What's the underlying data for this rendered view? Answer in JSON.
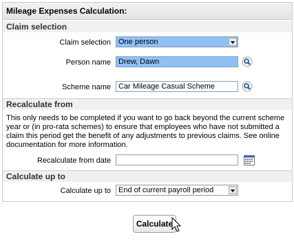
{
  "panel": {
    "title": "Mileage Expenses Calculation:"
  },
  "claim": {
    "heading": "Claim selection",
    "claim_selection_label": "Claim selection",
    "claim_selection_value": "One person",
    "person_label": "Person name",
    "person_value": "Drew, Dawn",
    "scheme_label": "Scheme name",
    "scheme_value": "Car Mileage Casual Scheme"
  },
  "recalc": {
    "heading": "Recalculate from",
    "description": "This only needs to be completed if you want to go back beyond the current scheme year or (in pro-rata schemes) to ensure that employees who have not submitted a claim this period get the benefit of any adjustments to previous claims. See online documentation for more information.",
    "date_label": "Recalculate from date",
    "date_value": ""
  },
  "calc": {
    "heading": "Calculate up to",
    "label": "Calculate up to",
    "value": "End of current payroll period"
  },
  "actions": {
    "calculate_label": "Calculate"
  },
  "icons": {
    "lookup": "magnifier-icon",
    "calendar": "calendar-icon",
    "cursor": "mouse-pointer-icon"
  }
}
